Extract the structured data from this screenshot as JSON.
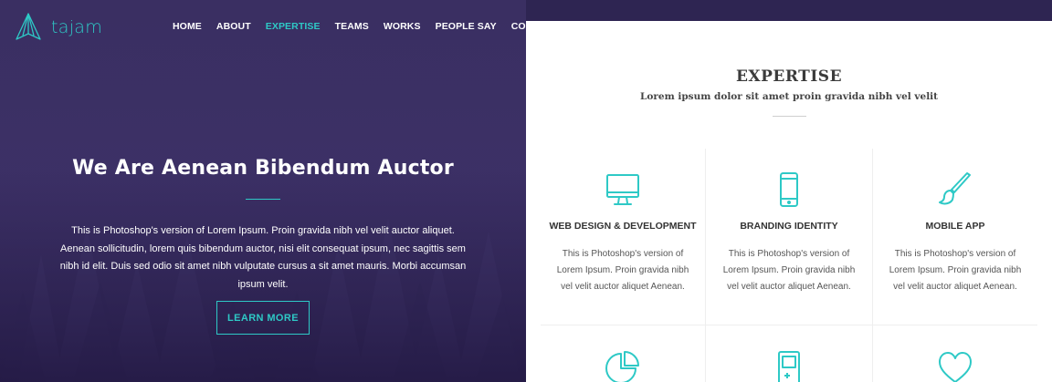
{
  "colors": {
    "accent": "#2ec9c6",
    "hero_bg": "#3a2f62",
    "topbar": "#2e2552"
  },
  "brand": {
    "name": "tajam",
    "icon": "paper-plane-logo-icon"
  },
  "nav": {
    "items": [
      {
        "label": "HOME",
        "active": false
      },
      {
        "label": "ABOUT",
        "active": false
      },
      {
        "label": "EXPERTISE",
        "active": true
      },
      {
        "label": "TEAMS",
        "active": false
      },
      {
        "label": "WORKS",
        "active": false
      },
      {
        "label": "PEOPLE SAY",
        "active": false
      },
      {
        "label": "CONTACT",
        "active": false
      }
    ]
  },
  "hero": {
    "title": "We Are Aenean Bibendum Auctor",
    "text": "This is Photoshop's version of Lorem Ipsum. Proin gravida nibh vel velit auctor aliquet. Aenean sollicitudin, lorem quis bibendum auctor, nisi elit consequat ipsum, nec sagittis sem nibh id elit. Duis sed odio sit amet nibh vulputate cursus a sit amet mauris. Morbi accumsan ipsum velit.",
    "button_label": "LEARN MORE"
  },
  "expertise": {
    "title": "EXPERTISE",
    "subtitle": "Lorem ipsum dolor sit amet proin gravida nibh vel velit",
    "items": [
      {
        "icon": "monitor-icon",
        "title": "WEB DESIGN & DEVELOPMENT",
        "desc": "This is Photoshop's version of Lorem Ipsum. Proin gravida nibh vel velit auctor aliquet Aenean."
      },
      {
        "icon": "mobile-phone-icon",
        "title": "BRANDING IDENTITY",
        "desc": "This is Photoshop's version of Lorem Ipsum. Proin gravida nibh vel velit auctor aliquet Aenean."
      },
      {
        "icon": "paint-brush-icon",
        "title": "MOBILE APP",
        "desc": "This is Photoshop's version of Lorem Ipsum. Proin gravida nibh vel velit auctor aliquet Aenean."
      },
      {
        "icon": "pie-chart-icon"
      },
      {
        "icon": "game-console-icon"
      },
      {
        "icon": "heart-icon"
      }
    ]
  }
}
